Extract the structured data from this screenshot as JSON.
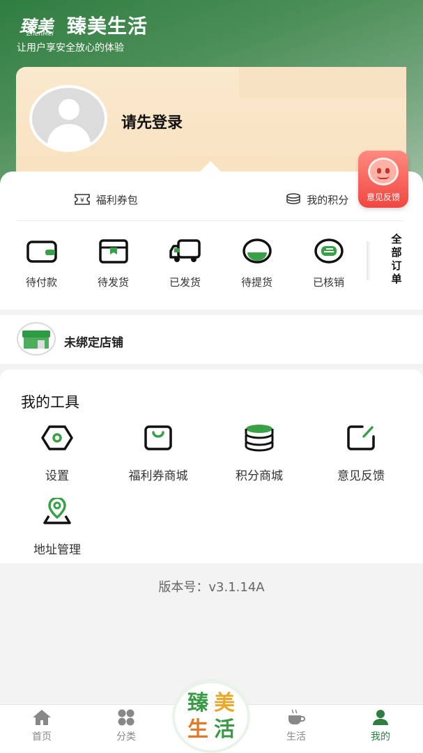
{
  "brand": {
    "logo_text": "臻美",
    "logo_sub": "ZhenMei",
    "name": "臻美生活",
    "slogan": "让用户享安全放心的体验"
  },
  "profile": {
    "login_prompt": "请先登录"
  },
  "feedback_float": {
    "label": "意见反馈"
  },
  "wallet": {
    "coupon_label": "福利券包",
    "points_label": "我的积分"
  },
  "orders": {
    "items": [
      {
        "label": "待付款",
        "icon": "wallet-icon"
      },
      {
        "label": "待发货",
        "icon": "box-icon"
      },
      {
        "label": "已发货",
        "icon": "truck-icon"
      },
      {
        "label": "待提货",
        "icon": "pickup-icon"
      },
      {
        "label": "已核销",
        "icon": "verified-icon"
      }
    ],
    "all_label": "全部订单"
  },
  "store": {
    "label": "未绑定店铺",
    "icon": "store-icon"
  },
  "tools": {
    "title": "我的工具",
    "items": [
      {
        "label": "设置",
        "icon": "settings-icon"
      },
      {
        "label": "福利券商城",
        "icon": "bag-icon"
      },
      {
        "label": "积分商城",
        "icon": "coins-icon"
      },
      {
        "label": "意见反馈",
        "icon": "edit-icon"
      },
      {
        "label": "地址管理",
        "icon": "location-icon"
      }
    ]
  },
  "version": "版本号：v3.1.14A",
  "tabbar": {
    "items": [
      {
        "label": "首页",
        "icon": "home-icon"
      },
      {
        "label": "分类",
        "icon": "category-icon"
      },
      {
        "label": "生活",
        "icon": "coffee-icon"
      },
      {
        "label": "我的",
        "icon": "user-icon",
        "active": true
      }
    ],
    "center_logo": [
      "臻",
      "美",
      "生",
      "活"
    ]
  },
  "colors": {
    "brand_green": "#2f7d41",
    "feedback_red": "#f0463f",
    "card_beige": "#fbe9cd"
  }
}
